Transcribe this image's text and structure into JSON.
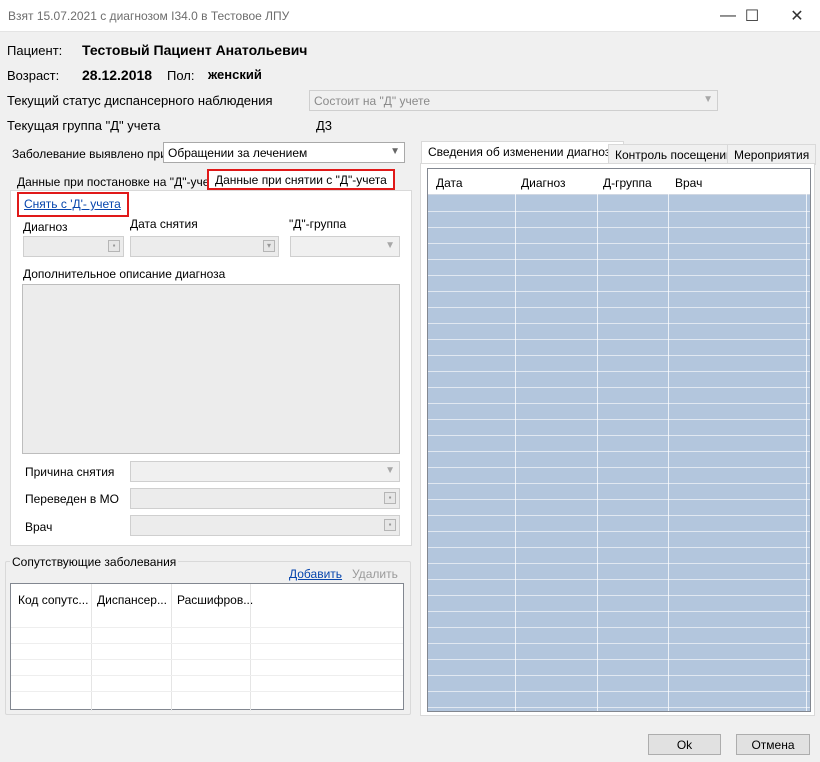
{
  "window": {
    "title": "Взят 15.07.2021 с диагнозом I34.0 в Тестовое ЛПУ",
    "minimize": "—",
    "maximize": "☐",
    "close": "✕"
  },
  "patient": {
    "label": "Пациент:",
    "name": "Тестовый Пациент Анатольевич",
    "age_label": "Возраст:",
    "dob": "28.12.2018",
    "sex_label": "Пол:",
    "sex": "женский"
  },
  "status": {
    "label": "Текущий статус диспансерного наблюдения",
    "value": "Состоит на \"Д\" учете"
  },
  "group": {
    "label": "Текущая группа \"Д\" учета",
    "value": "Д3"
  },
  "detected": {
    "label": "Заболевание выявлено при",
    "value": "Обращении за лечением"
  },
  "left_tabs": {
    "tab1": "Данные при постановке на \"Д\"-учет",
    "tab2": "Данные при снятии с \"Д\"-учета"
  },
  "removal": {
    "link": "Снять с 'Д'- учета",
    "diagnosis_label": "Диагноз",
    "date_label": "Дата снятия",
    "group_label": "\"Д\"-группа",
    "description_label": "Дополнительное описание диагноза",
    "reason_label": "Причина снятия",
    "transferred_label": "Переведен в МО",
    "doctor_label": "Врач"
  },
  "comorbid": {
    "title": "Сопутствующие заболевания",
    "add": "Добавить",
    "delete": "Удалить",
    "columns": [
      "Код сопутс...",
      "Диспансер...",
      "Расшифров..."
    ]
  },
  "right_tabs": {
    "tab1": "Сведения об изменении диагноза",
    "tab2": "Контроль посещений",
    "tab3": "Мероприятия"
  },
  "history": {
    "columns": [
      "Дата",
      "Диагноз",
      "Д-группа",
      "Врач"
    ]
  },
  "buttons": {
    "ok": "Ok",
    "cancel": "Отмена"
  },
  "colors": {
    "grid_fill": "#b3c6dd",
    "highlight": "#e01919",
    "link": "#0645ad"
  }
}
